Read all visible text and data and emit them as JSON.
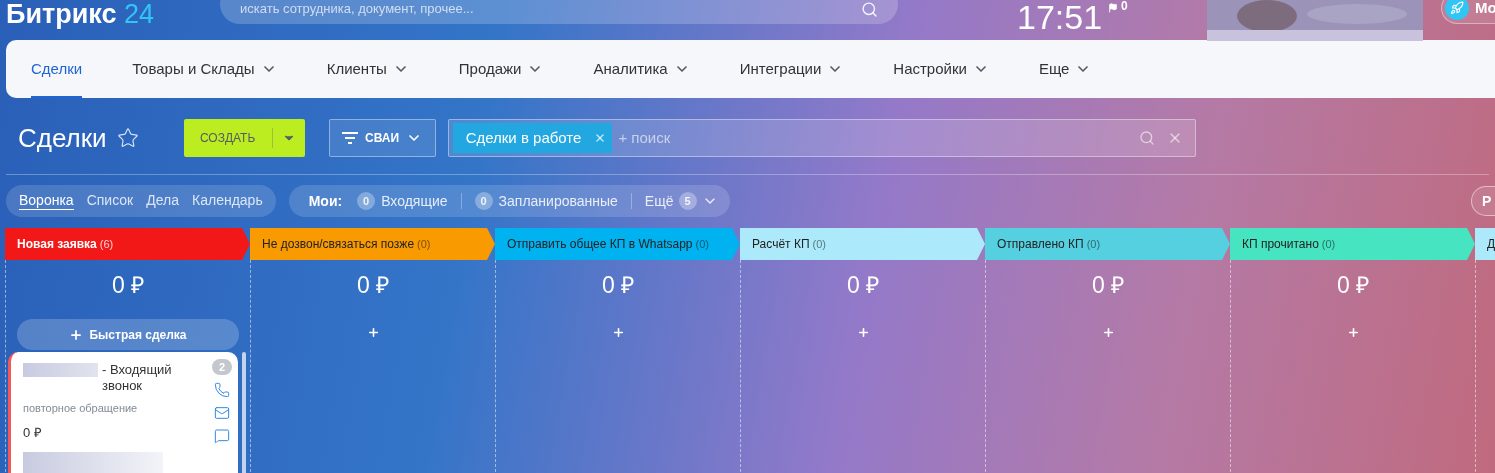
{
  "header": {
    "logo": {
      "name": "Битрикс",
      "suffix": "24"
    },
    "search": {
      "placeholder": "искать сотрудника, документ, прочее..."
    },
    "clock": "17:51",
    "flag_count": "0",
    "account_button": "Mo"
  },
  "nav": [
    {
      "label": "Сделки",
      "selected": true,
      "dropdown": false
    },
    {
      "label": "Товары и Склады",
      "selected": false,
      "dropdown": true
    },
    {
      "label": "Клиенты",
      "selected": false,
      "dropdown": true
    },
    {
      "label": "Продажи",
      "selected": false,
      "dropdown": true
    },
    {
      "label": "Аналитика",
      "selected": false,
      "dropdown": true
    },
    {
      "label": "Интеграции",
      "selected": false,
      "dropdown": true
    },
    {
      "label": "Настройки",
      "selected": false,
      "dropdown": true
    },
    {
      "label": "Еще",
      "selected": false,
      "dropdown": true
    }
  ],
  "page": {
    "title": "Сделки",
    "create": "СОЗДАТЬ",
    "filter_button": "СВАИ",
    "filter": {
      "tag": "Сделки в работе",
      "placeholder": "+ поиск"
    }
  },
  "views": [
    {
      "label": "Воронка",
      "selected": true
    },
    {
      "label": "Список",
      "selected": false
    },
    {
      "label": "Дела",
      "selected": false
    },
    {
      "label": "Календарь",
      "selected": false
    }
  ],
  "counters": {
    "label": "Мои:",
    "items": [
      {
        "count": "0",
        "label": "Входящие"
      },
      {
        "count": "0",
        "label": "Запланированные"
      }
    ],
    "more": {
      "label": "Ещё",
      "count": "5"
    }
  },
  "right_button": "Р",
  "stages": [
    {
      "title": "Новая заявка",
      "count": "(6)",
      "color": "#f21818",
      "inverted": true,
      "sum": "0 ₽",
      "quick_add": "Быстрая сделка"
    },
    {
      "title": "Не дозвон/связаться позже",
      "count": "(0)",
      "color": "#f89a00",
      "inverted": false,
      "sum": "0 ₽"
    },
    {
      "title": "Отправить общее КП в Whatsapp",
      "count": "(0)",
      "color": "#00b3f0",
      "inverted": false,
      "sum": "0 ₽"
    },
    {
      "title": "Расчёт КП",
      "count": "(0)",
      "color": "#ace9fa",
      "inverted": false,
      "sum": "0 ₽"
    },
    {
      "title": "Отправлено КП",
      "count": "(0)",
      "color": "#55d0e0",
      "inverted": false,
      "sum": "0 ₽"
    },
    {
      "title": "КП прочитано",
      "count": "(0)",
      "color": "#47e4c2",
      "inverted": false,
      "sum": "0 ₽"
    },
    {
      "title": "Д",
      "color": "#ace9fa",
      "inverted": false
    }
  ],
  "card": {
    "title": "- Входящий звонок",
    "subtitle": "повторное обращение",
    "amount": "0 ₽",
    "badge": "2"
  }
}
